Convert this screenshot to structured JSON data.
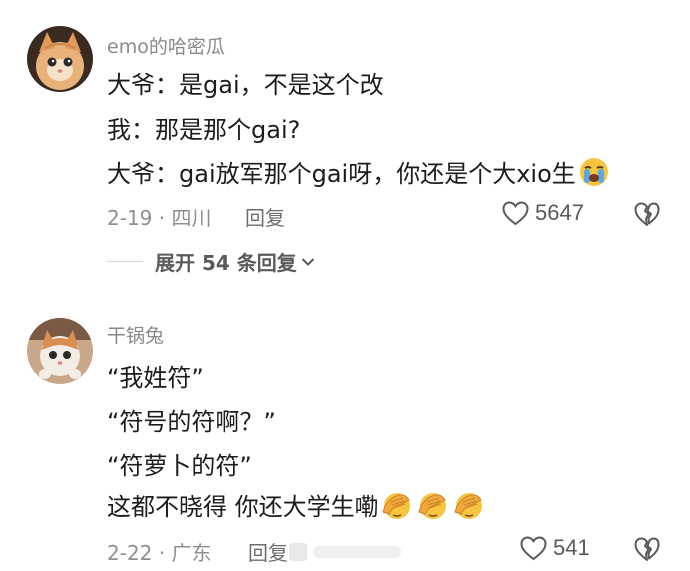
{
  "comments": [
    {
      "username": "emo的哈密瓜",
      "lines": [
        "大爷：是gai，不是这个改",
        "我：那是那个gai?",
        "大爷：gai放军那个gai呀，你还是个大xio生"
      ],
      "emoji": "loudly-crying-face-icon",
      "date_location": "2-19 · 四川",
      "reply_label": "回复",
      "like_count": "5647",
      "expand_replies": "展开 54 条回复"
    },
    {
      "username": "干锅兔",
      "lines": [
        "“我姓符”",
        "“符号的符啊？”",
        "“符萝卜的符”",
        "这都不晓得 你还大学生嘞"
      ],
      "emoji": "face-palm-icon",
      "emoji_count": 3,
      "date_location": "2-22 · 广东",
      "reply_label": "回复",
      "like_count": "541"
    }
  ],
  "colors": {
    "text": "#1c1c1c",
    "secondary": "#8a8a8a",
    "icon": "#5a5a5a"
  }
}
